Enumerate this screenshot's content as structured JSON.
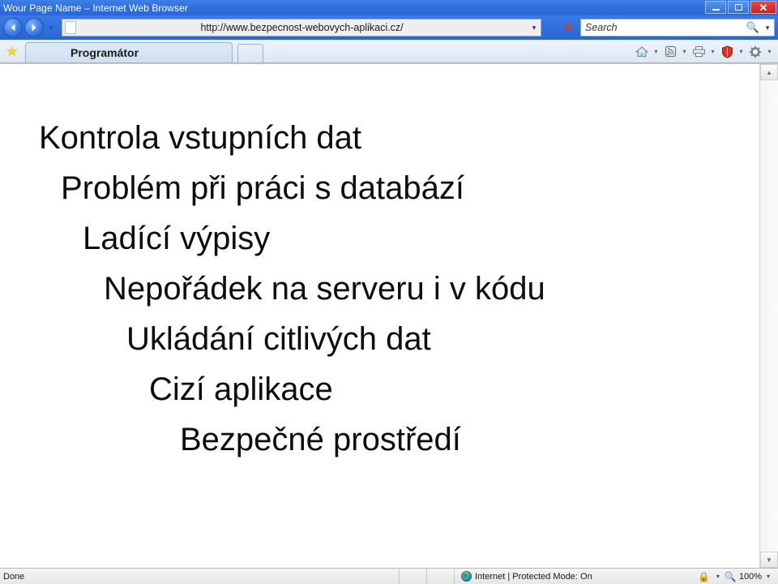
{
  "window": {
    "title": "Wour Page Name – Internet Web Browser",
    "minimize_label": "Minimize",
    "maximize_label": "Maximize",
    "close_label": "✕"
  },
  "navbar": {
    "back_label": "Back",
    "forward_label": "Forward",
    "history_caret": "▾",
    "address": {
      "url": "http://www.bezpecnost-webovych-aplikaci.cz/",
      "dropdown_caret": "▾",
      "favicon": "page-icon"
    },
    "refresh_label": "↻",
    "stop_label": "✕",
    "search": {
      "placeholder": "Search",
      "value": "Search",
      "icon": "🔍",
      "caret": "▾"
    }
  },
  "tabbar": {
    "favorites_label": "★",
    "tabs": [
      {
        "label": "Programátor",
        "active": true
      }
    ],
    "new_tab_label": "",
    "toolbar_icons": [
      {
        "name": "home-icon",
        "glyph": "⌂",
        "caret": "▾"
      },
      {
        "name": "feeds-icon",
        "glyph": "≈",
        "caret": "▾"
      },
      {
        "name": "print-icon",
        "glyph": "⎙",
        "caret": "▾"
      },
      {
        "name": "safety-shield-icon",
        "glyph": "⬟",
        "caret": "▾"
      },
      {
        "name": "settings-gear-icon",
        "glyph": "⚙",
        "caret": "▾"
      }
    ]
  },
  "page": {
    "lines": [
      {
        "text": "Kontrola vstupních dat",
        "indent": 48
      },
      {
        "text": "Problém při práci s databází",
        "indent": 75
      },
      {
        "text": "Ladící výpisy",
        "indent": 102
      },
      {
        "text": "Nepořádek na serveru i v kódu",
        "indent": 128
      },
      {
        "text": "Ukládání citlivých dat",
        "indent": 156
      },
      {
        "text": "Cizí aplikace",
        "indent": 184
      },
      {
        "text": "Bezpečné prostředí",
        "indent": 222
      }
    ]
  },
  "scrollbar": {
    "up_label": "▲",
    "down_label": "▼"
  },
  "statusbar": {
    "status": "Done",
    "zone": "Internet | Protected Mode: On",
    "zone_icon": "globe-icon",
    "privacy_icon": "🔒",
    "privacy_caret": "▾",
    "zoom_icon": "🔍",
    "zoom_level": "100%",
    "zoom_caret": "▾"
  },
  "colors": {
    "chrome_blue": "#2f6fdd",
    "close_red": "#c62020",
    "star_gold": "#f5d23c",
    "shield_red": "#d9342b",
    "accent_link": "#2f6fdd"
  }
}
